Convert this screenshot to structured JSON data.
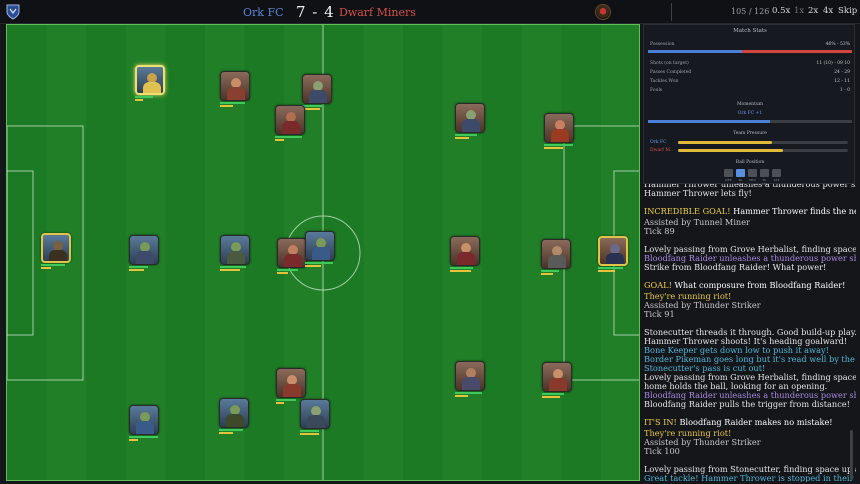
{
  "header": {
    "home_team": "Ork FC",
    "score": "7 - 4",
    "away_team": "Dwarf Miners",
    "tick": "105 / 126",
    "speeds": [
      "0.5x",
      "1x",
      "2x",
      "4x"
    ],
    "active_speed": "1x",
    "skip_label": "Skip",
    "home_color": "#5b86d6",
    "away_color": "#d6514c"
  },
  "pitch": {
    "players": [
      {
        "team": "home",
        "role": "carrier",
        "skin": "#caa24a",
        "kit": "#e0c050"
      },
      {
        "team": "away",
        "role": "",
        "skin": "#c98f6a",
        "kit": "#8a4030"
      },
      {
        "team": "away",
        "role": "",
        "skin": "#8aa070",
        "kit": "#3d4a6a"
      },
      {
        "team": "away",
        "role": "",
        "skin": "#b07050",
        "kit": "#7a2a2a"
      },
      {
        "team": "away",
        "role": "",
        "skin": "#8aa070",
        "kit": "#3d4a6a"
      },
      {
        "team": "away",
        "role": "",
        "skin": "#c98060",
        "kit": "#9a3a20"
      },
      {
        "team": "home",
        "role": "gk",
        "skin": "#7a6040",
        "kit": "#3a3020"
      },
      {
        "team": "home",
        "role": "",
        "skin": "#7a9a5a",
        "kit": "#3d4a6a"
      },
      {
        "team": "home",
        "role": "",
        "skin": "#7a9a5a",
        "kit": "#4a5a40"
      },
      {
        "team": "away",
        "role": "",
        "skin": "#c08060",
        "kit": "#7a2a2a"
      },
      {
        "team": "home",
        "role": "",
        "skin": "#7a9a5a",
        "kit": "#3a5a8a"
      },
      {
        "team": "away",
        "role": "",
        "skin": "#c98f6a",
        "kit": "#7a2a2a"
      },
      {
        "team": "away",
        "role": "",
        "skin": "#b08a6a",
        "kit": "#5a5a5a"
      },
      {
        "team": "away",
        "role": "gk",
        "skin": "#6a6a8a",
        "kit": "#2a3050"
      },
      {
        "team": "away",
        "role": "",
        "skin": "#c98f6a",
        "kit": "#8a3a2a"
      },
      {
        "team": "away",
        "role": "",
        "skin": "#b08060",
        "kit": "#4a4a6a"
      },
      {
        "team": "away",
        "role": "",
        "skin": "#c98f6a",
        "kit": "#8a3a2a"
      },
      {
        "team": "home",
        "role": "",
        "skin": "#7a9a5a",
        "kit": "#3a5a8a"
      },
      {
        "team": "home",
        "role": "",
        "skin": "#7a9a5a",
        "kit": "#3d4a2a"
      },
      {
        "team": "home",
        "role": "",
        "skin": "#8aa070",
        "kit": "#3a4a5a"
      }
    ]
  },
  "stats": {
    "title": "Match Stats",
    "possession_label": "Possession",
    "possession_value": "46% - 53%",
    "possession_home": 0.46,
    "rows": [
      {
        "label": "Shots (on target)",
        "value": "11 (10) - 09 10"
      },
      {
        "label": "Passes Completed",
        "value": "24 - 29"
      },
      {
        "label": "Tackles Won",
        "value": "12 - 11"
      },
      {
        "label": "Fouls",
        "value": "1 - 0"
      }
    ],
    "momentum_title": "Momentum",
    "momentum_text": "Ork FC +1",
    "momentum_home": 0.6,
    "pressure_title": "Team Pressure",
    "pressure": [
      {
        "team": "Ork FC",
        "level": 0.55
      },
      {
        "team": "Dwarf M..",
        "level": 0.62
      }
    ],
    "ball_title": "Ball Position",
    "zones": [
      "DEF",
      "M-DEF",
      "MID",
      "M-ATT",
      "ATT"
    ],
    "active_zone": 1
  },
  "commentary": [
    {
      "t": "Hammer Thrower unleashes a thunderous power shot!",
      "c": "w",
      "gap": 0
    },
    {
      "t": "Hammer Thrower lets fly!",
      "c": "w",
      "gap": 0
    },
    {
      "t": "INCREDIBLE GOAL! ",
      "em": "Hammer Thrower finds the net!",
      "c": "big",
      "gap": 9
    },
    {
      "t": "Assisted by Tunnel Miner",
      "c": "g",
      "gap": 0
    },
    {
      "t": "Tick 89",
      "c": "g",
      "gap": 0
    },
    {
      "t": "Lovely passing from Grove Herbalist, finding space up ahead.",
      "c": "w",
      "gap": 9
    },
    {
      "t": "Bloodfang Raider unleashes a thunderous power shot!",
      "c": "p",
      "gap": 0
    },
    {
      "t": "Strike from Bloodfang Raider! What power!",
      "c": "w",
      "gap": 0
    },
    {
      "t": "GOAL! ",
      "em": "What composure from Bloodfang Raider!",
      "c": "big",
      "gap": 9
    },
    {
      "t": "They're running riot!",
      "c": "y",
      "gap": 0
    },
    {
      "t": "Assisted by Thunder Striker",
      "c": "g",
      "gap": 0
    },
    {
      "t": "Tick 91",
      "c": "g",
      "gap": 0
    },
    {
      "t": "Stonecutter threads it through. Good build-up play.",
      "c": "w",
      "gap": 9
    },
    {
      "t": "Hammer Thrower shoots! It's heading goalward!",
      "c": "w",
      "gap": 0
    },
    {
      "t": "Bone Keeper gets down low to push it away!",
      "c": "b",
      "gap": 0
    },
    {
      "t": "Border Pikeman goes long but it's read well by the defence.",
      "c": "b",
      "gap": 0
    },
    {
      "t": "Stonecutter's pass is cut out!",
      "c": "b",
      "gap": 0
    },
    {
      "t": "Lovely passing from Grove Herbalist, finding space up ahead.",
      "c": "w",
      "gap": 0
    },
    {
      "t": "home holds the ball, looking for an opening.",
      "c": "w",
      "gap": 0
    },
    {
      "t": "Bloodfang Raider unleashes a thunderous power shot!",
      "c": "p",
      "gap": 0
    },
    {
      "t": "Bloodfang Raider pulls the trigger from distance!",
      "c": "w",
      "gap": 0
    },
    {
      "t": "IT'S IN! ",
      "em": "Bloodfang Raider makes no mistake!",
      "c": "big",
      "gap": 9
    },
    {
      "t": "They're running riot!",
      "c": "y",
      "gap": 0
    },
    {
      "t": "Assisted by Thunder Striker",
      "c": "g",
      "gap": 0
    },
    {
      "t": "Tick 100",
      "c": "g",
      "gap": 0
    },
    {
      "t": "Lovely passing from Stonecutter, finding space up ahead.",
      "c": "w",
      "gap": 9
    },
    {
      "t": "Great tackle! Hammer Thrower is stopped in their tracks.",
      "c": "b",
      "gap": 0
    }
  ]
}
